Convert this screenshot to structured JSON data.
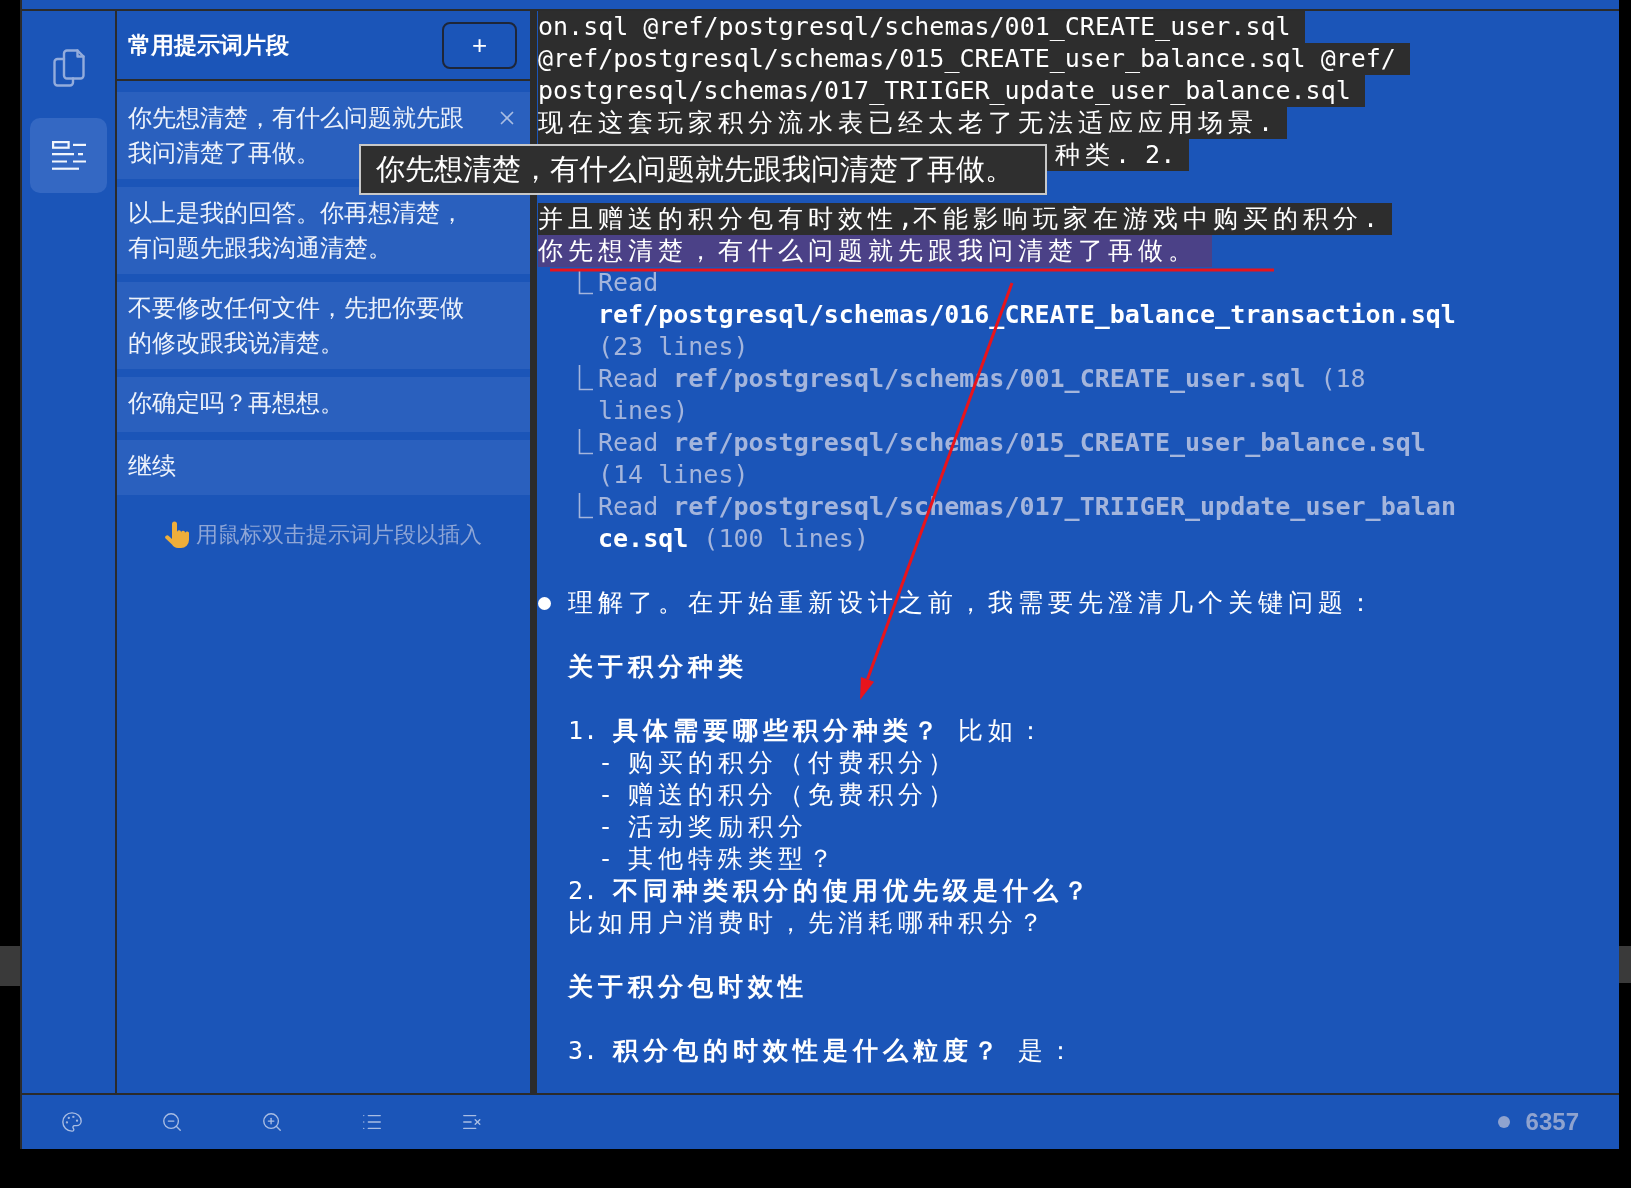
{
  "activity_bar": {
    "items": [
      {
        "selected": false
      },
      {
        "selected": true
      }
    ]
  },
  "snippets": {
    "title": "常用提示词片段",
    "add_button": "+",
    "items": [
      {
        "text": "你先想清楚，有什么问题就先跟我问清楚了再做。",
        "hovered": true
      },
      {
        "text": "以上是我的回答。你再想清楚，有问题先跟我沟通清楚。",
        "hovered": false
      },
      {
        "text": "不要修改任何文件，先把你要做的修改跟我说清楚。",
        "hovered": false
      },
      {
        "text": "你确定吗？再想想。",
        "hovered": false
      },
      {
        "text": "继续",
        "hovered": false
      }
    ],
    "hint": "用鼠标双击提示词片段以插入"
  },
  "tooltip": {
    "text": "你先想清楚，有什么问题就先跟我问清楚了再做。"
  },
  "terminal": {
    "prompt_lines": [
      {
        "kind": "message",
        "text": "on.sql @ref/postgresql/schemas/001_CREATE_user.sql"
      },
      {
        "kind": "message",
        "text": "@ref/postgresql/schemas/015_CREATE_user_balance.sql @ref/"
      },
      {
        "kind": "message",
        "text": "postgresql/schemas/017_TRIIGER_update_user_balance.sql"
      },
      {
        "kind": "message",
        "text": "现在这套玩家积分流水表已经太老了无法适应应用场景."
      },
      {
        "kind": "covered",
        "text": "种类. 2."
      },
      {
        "kind": "message",
        "text": "并且赠送的积分包有时效性,不能影响玩家在游戏中购买的积分."
      },
      {
        "kind": "inserted",
        "text": "你先想清楚，有什么问题就先跟我问清楚了再做。"
      }
    ],
    "tool_reads": [
      {
        "lines": [
          {
            "segments": [
              {
                "text": "Read",
                "bold": false,
                "bright": false
              }
            ]
          },
          {
            "segments": [
              {
                "text": "ref/postgresql/schemas/016_CREATE_balance_transaction.sql",
                "bold": true,
                "bright": true
              }
            ]
          },
          {
            "segments": [
              {
                "text": "(23 lines)",
                "bold": false,
                "bright": false
              }
            ]
          }
        ]
      },
      {
        "lines": [
          {
            "segments": [
              {
                "text": "Read ",
                "bold": false,
                "bright": false
              },
              {
                "text": "ref/postgresql/schemas/001_CREATE_user.sql",
                "bold": true,
                "bright": false
              },
              {
                "text": " (18",
                "bold": false,
                "bright": false
              }
            ]
          },
          {
            "segments": [
              {
                "text": "lines)",
                "bold": false,
                "bright": false
              }
            ]
          }
        ]
      },
      {
        "lines": [
          {
            "segments": [
              {
                "text": "Read ",
                "bold": false,
                "bright": false
              },
              {
                "text": "ref/postgresql/schemas/015_CREATE_user_balance.sql",
                "bold": true,
                "bright": false
              }
            ]
          },
          {
            "segments": [
              {
                "text": "(14 lines)",
                "bold": false,
                "bright": false
              }
            ]
          }
        ]
      },
      {
        "lines": [
          {
            "segments": [
              {
                "text": "Read ",
                "bold": false,
                "bright": false
              },
              {
                "text": "ref/postgresql/schemas/017_TRIIGER_update_user_balan",
                "bold": true,
                "bright": false
              }
            ]
          },
          {
            "segments": [
              {
                "text": "ce.sql",
                "bold": true,
                "bright": true
              },
              {
                "text": " (100 lines)",
                "bold": false,
                "bright": false
              }
            ]
          }
        ]
      }
    ],
    "answer": {
      "intro": "理解了。在开始重新设计之前，我需要先澄清几个关键问题：",
      "sections": [
        {
          "heading": "关于积分种类",
          "lines": [
            {
              "kind": "question",
              "text": "1. **具体需要哪些积分种类？** 比如："
            },
            {
              "kind": "option",
              "text": "- 购买的积分（付费积分）"
            },
            {
              "kind": "option",
              "text": "- 赠送的积分（免费积分）"
            },
            {
              "kind": "option",
              "text": "- 活动奖励积分"
            },
            {
              "kind": "option",
              "text": "- 其他特殊类型？"
            },
            {
              "kind": "question",
              "text": "2. **不同种类积分的使用优先级是什么？**"
            },
            {
              "kind": "detail",
              "text": "比如用户消费时，先消耗哪种积分？"
            }
          ]
        },
        {
          "heading": "关于积分包时效性",
          "lines": [
            {
              "kind": "question",
              "text": "3. **积分包的时效性是什么粒度？** 是："
            }
          ]
        }
      ]
    }
  },
  "status_bar": {
    "count": "6357"
  }
}
